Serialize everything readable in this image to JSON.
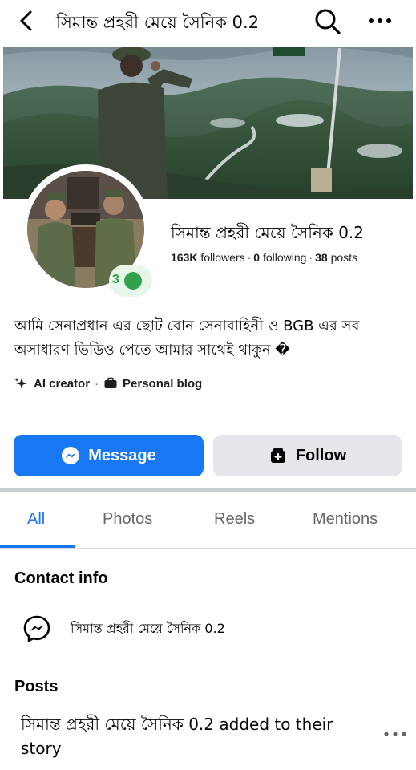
{
  "header": {
    "title": "সিমান্ত প্রহরী মেয়ে সৈনিক 0.2"
  },
  "profile": {
    "name": "সিমান্ত প্রহরী মেয়ে সৈনিক 0.2",
    "followers_count": "163K",
    "followers_label": "followers",
    "following_count": "0",
    "following_label": "following",
    "posts_count": "38",
    "posts_label": "posts",
    "status_text": "3",
    "bio": "আমি সেনাপ্রধান এর ছোট বোন সেনাবাহিনী ও BGB এর সব অসাধারণ ভিডিও পেতে আমার সাথেই থাকুন �",
    "tags": [
      {
        "icon": "sparkle-icon",
        "label": "AI creator"
      },
      {
        "icon": "briefcase-icon",
        "label": "Personal blog"
      }
    ]
  },
  "actions": {
    "message_label": "Message",
    "follow_label": "Follow"
  },
  "tabs": [
    {
      "label": "All",
      "active": true
    },
    {
      "label": "Photos",
      "active": false
    },
    {
      "label": "Reels",
      "active": false
    },
    {
      "label": "Mentions",
      "active": false
    }
  ],
  "contact": {
    "heading": "Contact info",
    "messenger_name": "সিমান্ত প্রহরী মেয়ে সৈনিক 0.2"
  },
  "posts": {
    "heading": "Posts",
    "first_post_text": "সিমান্ত প্রহরী মেয়ে সৈনিক 0.2 added to their story"
  },
  "colors": {
    "accent": "#1877f2",
    "online": "#31a24c",
    "secondary_button": "#e4e6eb",
    "muted_text": "#65676b"
  }
}
